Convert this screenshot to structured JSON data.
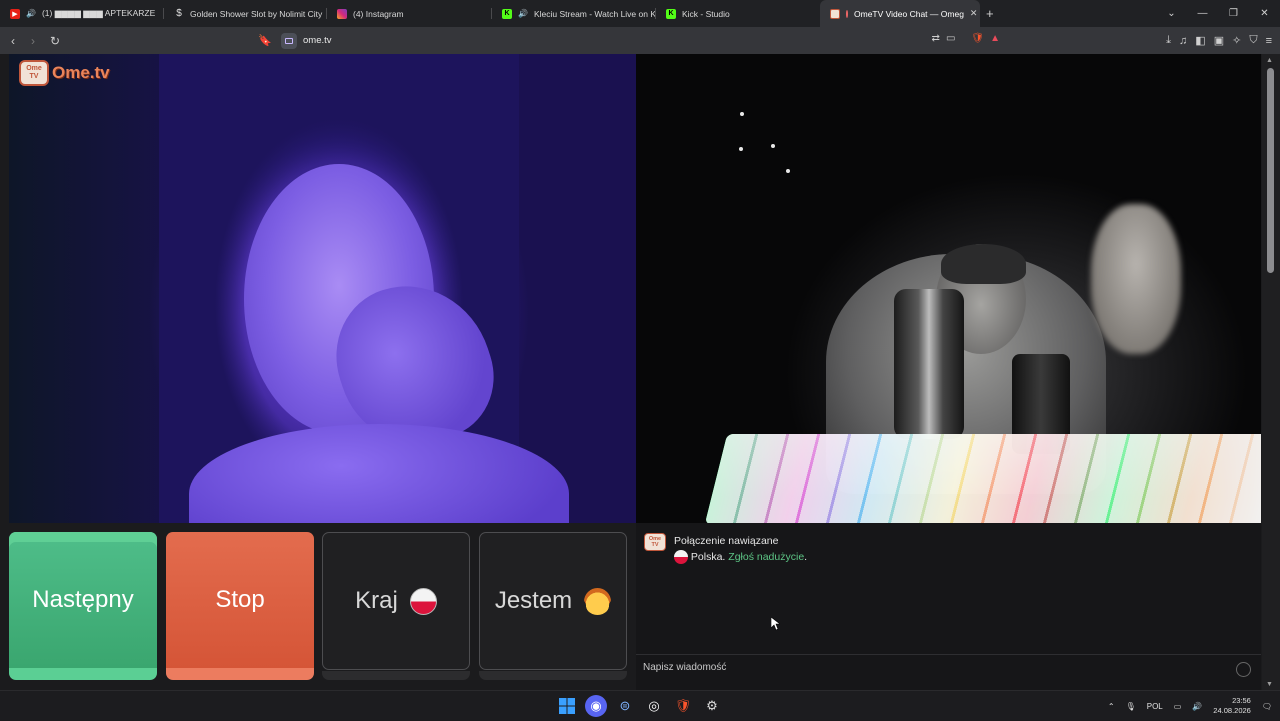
{
  "browser": {
    "tabs": [
      {
        "label": "(1) ▆▆▆▆ ▆▆▆ APTEKARZE",
        "favicon": "youtube-icon",
        "color": "#e62117",
        "audio": true
      },
      {
        "label": "Golden Shower Slot by Nolimit City",
        "favicon": "dollar-icon",
        "color": "#3a3a3a",
        "audio": false
      },
      {
        "label": "(4) Instagram",
        "favicon": "instagram-icon",
        "color": "#d6297b",
        "audio": false
      },
      {
        "label": "Kleciu Stream - Watch Live on Ki",
        "favicon": "kick-icon",
        "color": "#53fc18",
        "audio": true
      },
      {
        "label": "Kick - Studio",
        "favicon": "kick-icon",
        "color": "#53fc18",
        "audio": false
      },
      {
        "label": "OmeTV Video Chat — Omeg",
        "favicon": "ometv-icon",
        "color": "#e9845b",
        "audio": false,
        "active": true
      }
    ],
    "url": "ome.tv"
  },
  "page": {
    "logo_text": "Ome.tv",
    "logo_badge": "Ome TV",
    "buttons": {
      "next": "Następny",
      "stop": "Stop",
      "country": "Kraj",
      "me": "Jestem"
    },
    "chat": {
      "system_title": "Połączenie nawiązane",
      "country_text": "Polska.",
      "report_link": "Zgłoś nadużycie",
      "report_suffix": ".",
      "input_placeholder": "Napisz wiadomość"
    }
  },
  "taskbar": {
    "language": "POL",
    "time": "23:56",
    "date": "24.08.2026"
  },
  "colors": {
    "next_button": "#3aa66f",
    "stop_button": "#d55537",
    "link": "#5dc585",
    "brand": "#e9845b"
  }
}
